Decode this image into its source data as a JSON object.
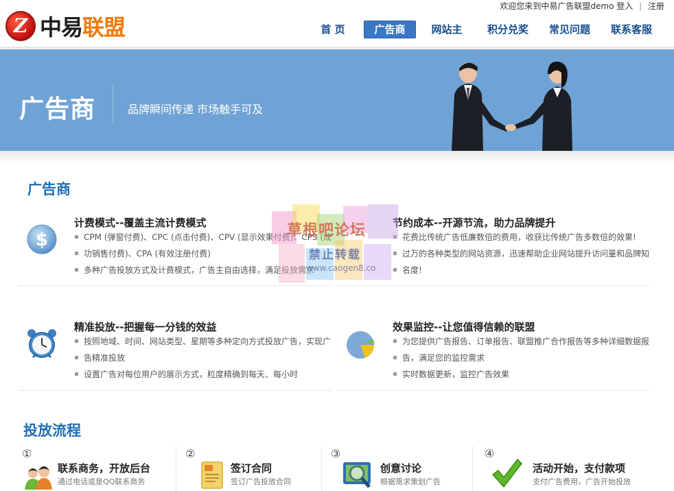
{
  "topbar": {
    "welcome": "欢迎您来到中易广告联盟demo",
    "login": "登入",
    "separator": "|",
    "register": "注册"
  },
  "logo": {
    "letter": "Z",
    "name_part1": "中易",
    "name_part2": "联盟"
  },
  "nav": [
    {
      "label": "首 页"
    },
    {
      "label": "广告商"
    },
    {
      "label": "网站主"
    },
    {
      "label": "积分兑奖"
    },
    {
      "label": "常见问题"
    },
    {
      "label": "联系客服"
    }
  ],
  "nav_active": "广告商",
  "banner": {
    "title": "广告商",
    "subtitle": "品牌瞬间传递 市场触手可及"
  },
  "section1": {
    "title": "广告商"
  },
  "features": [
    {
      "icon": "dollar-coin-icon",
      "title": "计费模式--覆盖主流计费模式",
      "items": [
        "CPM (弹窗付费)、CPC (点击付费)、CPV (显示效果付费)、CPS (成",
        "功销售付费)、CPA (有效注册付费)",
        "多种广告投放方式及计费模式，广告主自由选择，满足投放需求"
      ]
    },
    {
      "icon": "piggy-savings-icon",
      "title": "节约成本--开源节流，助力品牌提升",
      "items": [
        "花费比传统广告低廉数倍的费用，收获比传统广告多数倍的效果!",
        "过万的各种类型的网站资源，迅速帮助企业网站提升访问量和品牌知",
        "名度!"
      ]
    },
    {
      "icon": "alarm-clock-icon",
      "title": "精准投放--把握每一分钱的效益",
      "items": [
        "按照地域、时间、网站类型、星期等多种定向方式投放广告，实现广",
        "告精准投放",
        "设置广告对每位用户的展示方式，粒度精确到每天、每小时"
      ]
    },
    {
      "icon": "pie-chart-icon",
      "title": "效果监控--让您值得信赖的联盟",
      "items": [
        "为您提供广告报告、订单报告、联盟推广合作报告等多种详细数据报",
        "告，满足您的监控需求",
        "实时数据更新，监控广告效果"
      ]
    }
  ],
  "watermark": {
    "line1": "草根吧论坛",
    "line2": "禁止转载",
    "line3": "www.caogen8.co"
  },
  "section2": {
    "title": "投放流程"
  },
  "steps": [
    {
      "num": "①",
      "icon": "contact-people-icon",
      "title": "联系商务，开放后台",
      "desc": "通过电话或是QQ联系商务"
    },
    {
      "num": "②",
      "icon": "contract-document-icon",
      "title": "签订合同",
      "desc": "签订广告投放合同"
    },
    {
      "num": "③",
      "icon": "magnifier-image-icon",
      "title": "创意讨论",
      "desc": "根据需求策划广告"
    },
    {
      "num": "④",
      "icon": "checkmark-icon",
      "title": "活动开始，支付款项",
      "desc": "支付广告费用，广告开始投放"
    }
  ],
  "colors": {
    "accent": "#1f6fb4",
    "banner": "#6fa3d5",
    "nav_active": "#3b78c3",
    "logo_orange": "#f07a0b"
  }
}
